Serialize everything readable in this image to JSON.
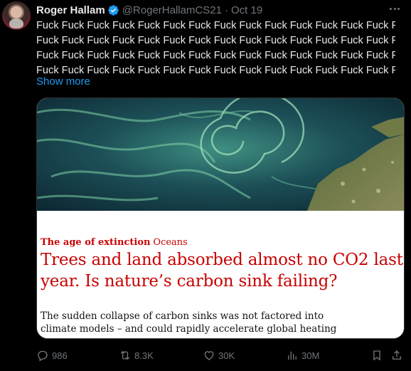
{
  "author": {
    "name": "Roger Hallam",
    "handle": "@RogerHallamCS21",
    "separator": "·",
    "date": "Oct 19"
  },
  "tweet": {
    "lines": [
      "Fuck Fuck Fuck Fuck Fuck Fuck Fuck Fuck Fuck Fuck Fuck Fuck Fuck Fuck Fuck",
      "Fuck Fuck Fuck Fuck Fuck Fuck Fuck Fuck Fuck Fuck Fuck Fuck Fuck Fuck Fuck",
      "Fuck Fuck Fuck Fuck Fuck Fuck Fuck Fuck Fuck Fuck Fuck Fuck Fuck Fuck Fuck",
      "Fuck Fuck Fuck Fuck Fuck Fuck Fuck Fuck Fuck Fuck Fuck Fuck Fuck Fuck Fuck"
    ],
    "show_more": "Show more"
  },
  "card": {
    "section": "The age of extinction",
    "subsection": "Oceans",
    "headline": "Trees and land absorbed almost no CO2 last year. Is nature’s carbon sink failing?",
    "standfirst_lines": [
      "The sudden collapse of carbon sinks was not factored into",
      "climate models – and could rapidly accelerate global heating"
    ]
  },
  "actions": {
    "replies": "986",
    "reposts": "8.3K",
    "likes": "30K",
    "views": "30M"
  },
  "colors": {
    "background": "#000000",
    "link": "#1d9bf0",
    "muted": "#71767b",
    "verified": "#1d9bf0",
    "guardian_red": "#c70000"
  },
  "icons": [
    "verified-badge-icon",
    "more-icon",
    "reply-icon",
    "repost-icon",
    "like-icon",
    "views-icon",
    "bookmark-icon",
    "share-icon"
  ]
}
